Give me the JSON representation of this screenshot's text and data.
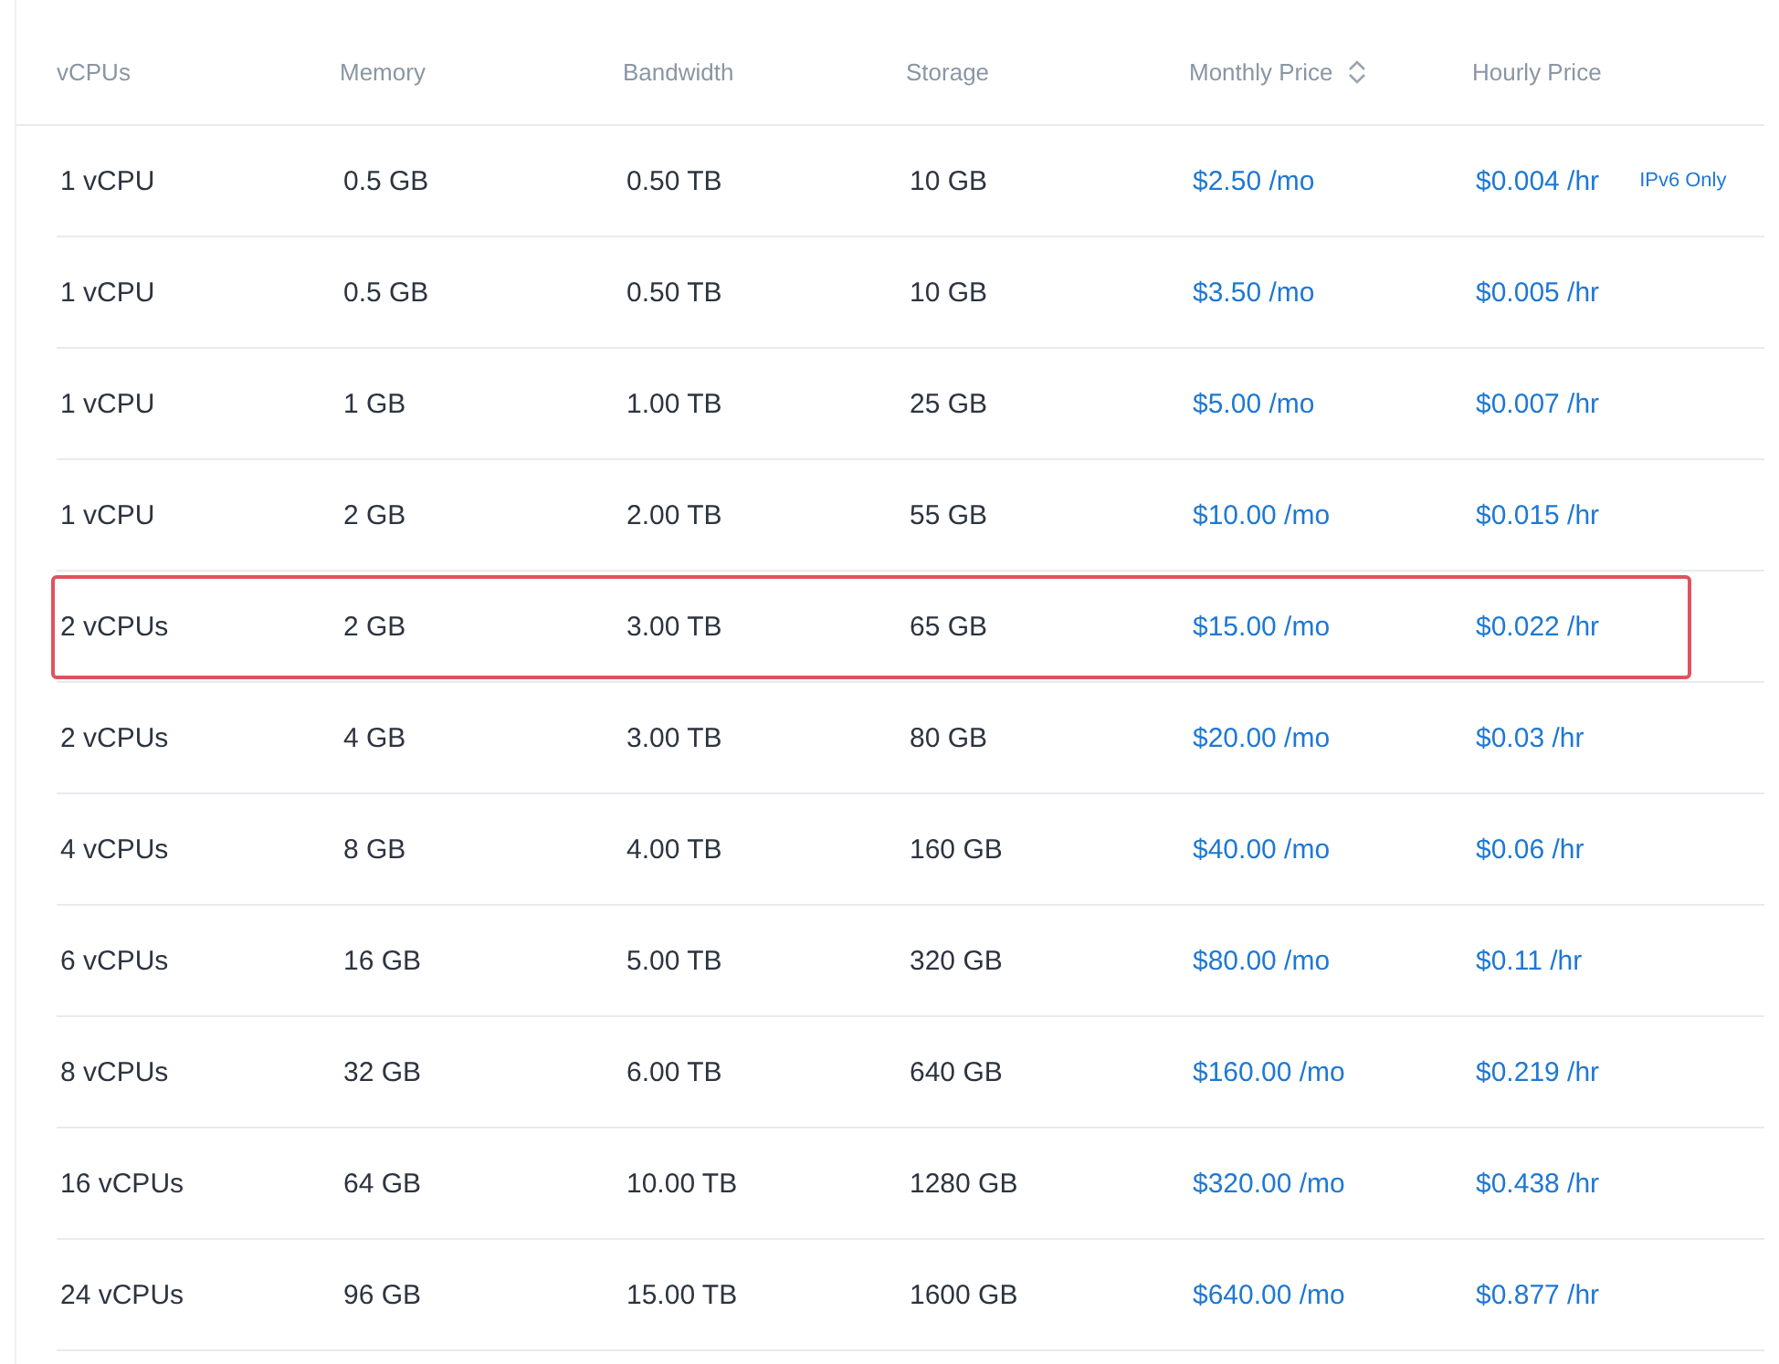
{
  "table": {
    "columns": [
      {
        "label": "vCPUs",
        "sortable": false
      },
      {
        "label": "Memory",
        "sortable": false
      },
      {
        "label": "Bandwidth",
        "sortable": false
      },
      {
        "label": "Storage",
        "sortable": false
      },
      {
        "label": "Monthly Price",
        "sortable": true
      },
      {
        "label": "Hourly Price",
        "sortable": false
      }
    ],
    "rows": [
      {
        "vcpus": "1 vCPU",
        "memory": "0.5 GB",
        "bandwidth": "0.50 TB",
        "storage": "10 GB",
        "monthly": "$2.50 /mo",
        "hourly": "$0.004 /hr",
        "badge": "IPv6 Only",
        "highlighted": false
      },
      {
        "vcpus": "1 vCPU",
        "memory": "0.5 GB",
        "bandwidth": "0.50 TB",
        "storage": "10 GB",
        "monthly": "$3.50 /mo",
        "hourly": "$0.005 /hr",
        "highlighted": false
      },
      {
        "vcpus": "1 vCPU",
        "memory": "1 GB",
        "bandwidth": "1.00 TB",
        "storage": "25 GB",
        "monthly": "$5.00 /mo",
        "hourly": "$0.007 /hr",
        "highlighted": false
      },
      {
        "vcpus": "1 vCPU",
        "memory": "2 GB",
        "bandwidth": "2.00 TB",
        "storage": "55 GB",
        "monthly": "$10.00 /mo",
        "hourly": "$0.015 /hr",
        "highlighted": false
      },
      {
        "vcpus": "2 vCPUs",
        "memory": "2 GB",
        "bandwidth": "3.00 TB",
        "storage": "65 GB",
        "monthly": "$15.00 /mo",
        "hourly": "$0.022 /hr",
        "highlighted": true
      },
      {
        "vcpus": "2 vCPUs",
        "memory": "4 GB",
        "bandwidth": "3.00 TB",
        "storage": "80 GB",
        "monthly": "$20.00 /mo",
        "hourly": "$0.03 /hr",
        "highlighted": false
      },
      {
        "vcpus": "4 vCPUs",
        "memory": "8 GB",
        "bandwidth": "4.00 TB",
        "storage": "160 GB",
        "monthly": "$40.00 /mo",
        "hourly": "$0.06 /hr",
        "highlighted": false
      },
      {
        "vcpus": "6 vCPUs",
        "memory": "16 GB",
        "bandwidth": "5.00 TB",
        "storage": "320 GB",
        "monthly": "$80.00 /mo",
        "hourly": "$0.11 /hr",
        "highlighted": false
      },
      {
        "vcpus": "8 vCPUs",
        "memory": "32 GB",
        "bandwidth": "6.00 TB",
        "storage": "640 GB",
        "monthly": "$160.00 /mo",
        "hourly": "$0.219 /hr",
        "highlighted": false
      },
      {
        "vcpus": "16 vCPUs",
        "memory": "64 GB",
        "bandwidth": "10.00 TB",
        "storage": "1280 GB",
        "monthly": "$320.00 /mo",
        "hourly": "$0.438 /hr",
        "highlighted": false
      },
      {
        "vcpus": "24 vCPUs",
        "memory": "96 GB",
        "bandwidth": "15.00 TB",
        "storage": "1600 GB",
        "monthly": "$640.00 /mo",
        "hourly": "$0.877 /hr",
        "highlighted": false
      }
    ]
  }
}
